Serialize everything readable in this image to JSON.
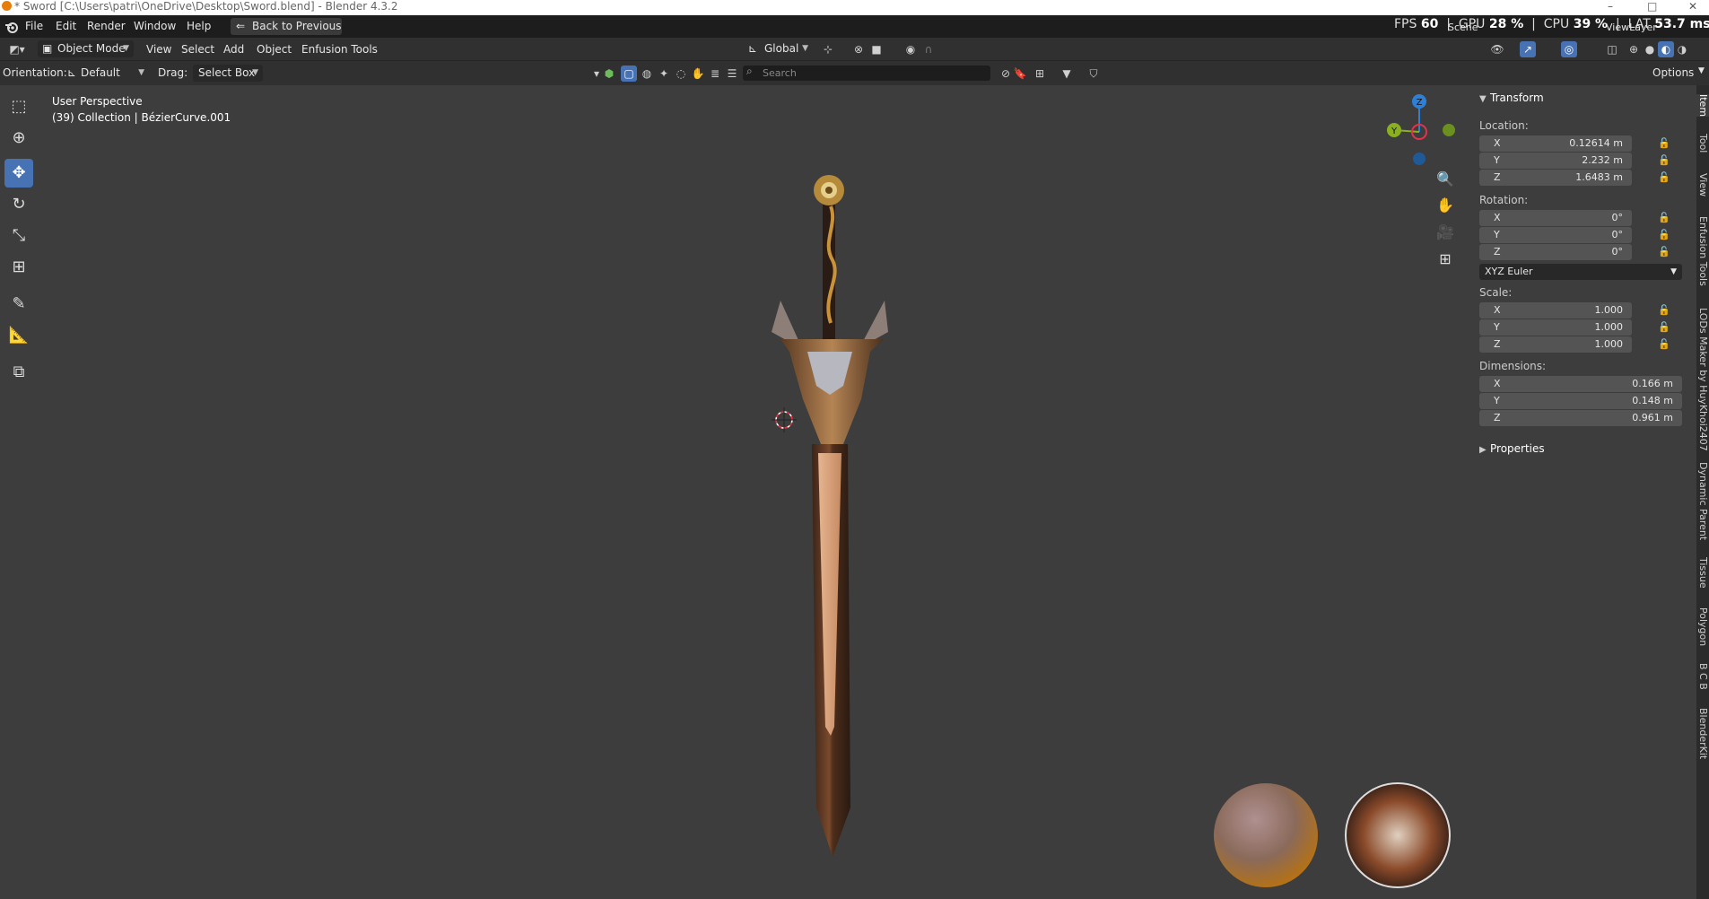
{
  "window": {
    "title": "* Sword [C:\\Users\\patri\\OneDrive\\Desktop\\Sword.blend] - Blender 4.3.2",
    "minimize": "–",
    "maximize": "□",
    "close": "✕"
  },
  "menubar": {
    "items": [
      "File",
      "Edit",
      "Render",
      "Window",
      "Help"
    ],
    "back_button": "Back to Previous",
    "stats": {
      "fps_label": "FPS",
      "fps_value": "60",
      "gpu_label": "GPU",
      "gpu_value": "28 %",
      "cpu_label": "CPU",
      "cpu_value": "39 %",
      "lat_label": "LAT",
      "lat_value": "53.7 ms"
    },
    "scene_label": "Scene",
    "viewlayer_label": "ViewLayer"
  },
  "header": {
    "mode": "Object Mode",
    "menus": [
      "View",
      "Select",
      "Add",
      "Object",
      "Enfusion Tools"
    ],
    "transform_orientation": "Global"
  },
  "tool_settings": {
    "orientation_label": "Orientation:",
    "orientation_value": "Default",
    "drag_label": "Drag:",
    "drag_value": "Select Box",
    "search_placeholder": "Search",
    "options_label": "Options"
  },
  "viewport": {
    "view_name": "User Perspective",
    "collection_info": "(39) Collection | BézierCurve.001",
    "gizmo": {
      "x": "X",
      "y": "Y",
      "z": "Z"
    }
  },
  "npanel": {
    "transform_title": "Transform",
    "location_label": "Location:",
    "location": [
      {
        "axis": "X",
        "value": "0.12614 m"
      },
      {
        "axis": "Y",
        "value": "2.232 m"
      },
      {
        "axis": "Z",
        "value": "1.6483 m"
      }
    ],
    "rotation_label": "Rotation:",
    "rotation": [
      {
        "axis": "X",
        "value": "0°"
      },
      {
        "axis": "Y",
        "value": "0°"
      },
      {
        "axis": "Z",
        "value": "0°"
      }
    ],
    "rotation_mode": "XYZ Euler",
    "scale_label": "Scale:",
    "scale": [
      {
        "axis": "X",
        "value": "1.000"
      },
      {
        "axis": "Y",
        "value": "1.000"
      },
      {
        "axis": "Z",
        "value": "1.000"
      }
    ],
    "dimensions_label": "Dimensions:",
    "dimensions": [
      {
        "axis": "X",
        "value": "0.166 m"
      },
      {
        "axis": "Y",
        "value": "0.148 m"
      },
      {
        "axis": "Z",
        "value": "0.961 m"
      }
    ],
    "properties_title": "Properties"
  },
  "sidebar_tabs": [
    "Item",
    "Tool",
    "View",
    "Enfusion Tools",
    "LODs Maker by HuyKhoi2407",
    "Dynamic Parent",
    "Tissue",
    "Polygon",
    "B C B",
    "BlenderKit"
  ],
  "colors": {
    "accent": "#4772b3",
    "axis_x": "#e2334b",
    "axis_y": "#8ab020",
    "axis_z": "#2e80d6"
  }
}
